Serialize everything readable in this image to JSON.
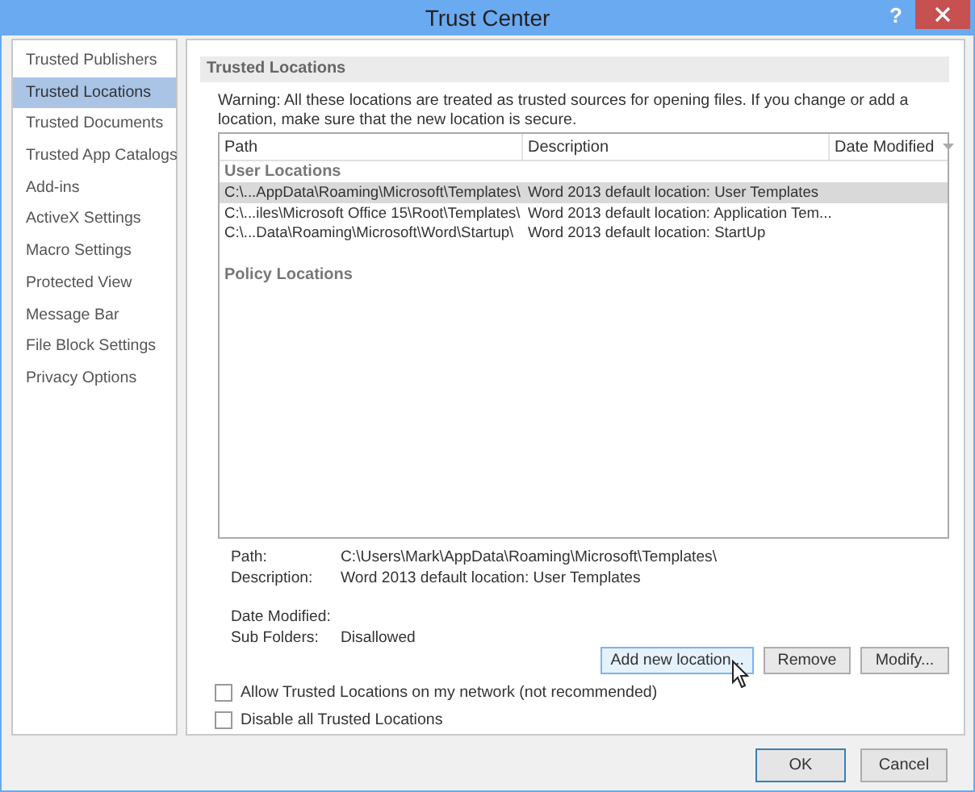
{
  "window": {
    "title": "Trust Center",
    "help": "?"
  },
  "sidebar": {
    "items": [
      {
        "label": "Trusted Publishers",
        "selected": false
      },
      {
        "label": "Trusted Locations",
        "selected": true
      },
      {
        "label": "Trusted Documents",
        "selected": false
      },
      {
        "label": "Trusted App Catalogs",
        "selected": false
      },
      {
        "label": "Add-ins",
        "selected": false
      },
      {
        "label": "ActiveX Settings",
        "selected": false
      },
      {
        "label": "Macro Settings",
        "selected": false
      },
      {
        "label": "Protected View",
        "selected": false
      },
      {
        "label": "Message Bar",
        "selected": false
      },
      {
        "label": "File Block Settings",
        "selected": false
      },
      {
        "label": "Privacy Options",
        "selected": false
      }
    ]
  },
  "section": {
    "title": "Trusted Locations",
    "warning": "Warning: All these locations are treated as trusted sources for opening files.  If you change or add a location, make sure that the new location is secure."
  },
  "table": {
    "columns": [
      {
        "label": "Path",
        "dropdown": false
      },
      {
        "label": "Description",
        "dropdown": false
      },
      {
        "label": "Date Modified",
        "dropdown": true
      }
    ],
    "groups": [
      {
        "heading": "User Locations",
        "rows": [
          {
            "path": "C:\\...AppData\\Roaming\\Microsoft\\Templates\\",
            "description": "Word 2013 default location: User Templates",
            "selected": true
          },
          {
            "path": "C:\\...iles\\Microsoft Office 15\\Root\\Templates\\",
            "description": "Word 2013 default location: Application Tem...",
            "selected": false
          },
          {
            "path": "C:\\...Data\\Roaming\\Microsoft\\Word\\Startup\\",
            "description": "Word 2013 default location: StartUp",
            "selected": false
          }
        ]
      },
      {
        "heading": "Policy Locations"
      }
    ]
  },
  "details": [
    {
      "label": "Path:",
      "value": "C:\\Users\\Mark\\AppData\\Roaming\\Microsoft\\Templates\\"
    },
    {
      "label": "Description:",
      "value": "Word 2013 default location: User Templates"
    },
    {
      "label": "Date Modified:"
    },
    {
      "label": "Sub Folders:",
      "value": "Disallowed"
    }
  ],
  "buttons": [
    {
      "label": "Add new location...",
      "focused": true
    },
    {
      "label": "Remove",
      "focused": false
    },
    {
      "label": "Modify...",
      "focused": false
    }
  ],
  "checkboxes": [
    {
      "label": "Allow Trusted Locations on my network (not recommended)",
      "checked": false
    },
    {
      "label": "Disable all Trusted Locations",
      "checked": false
    }
  ],
  "footer": [
    {
      "label": "OK",
      "default": true
    },
    {
      "label": "Cancel",
      "default": false
    }
  ]
}
